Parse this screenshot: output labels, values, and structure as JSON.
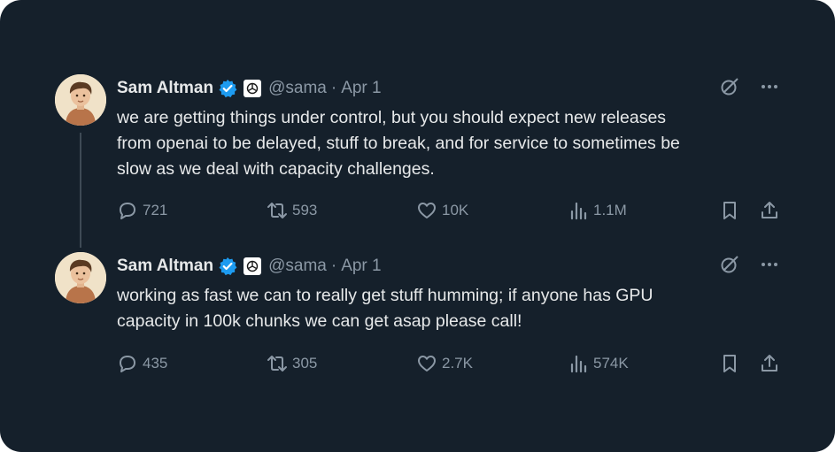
{
  "tweets": [
    {
      "author_name": "Sam Altman",
      "handle": "@sama",
      "separator": "·",
      "date": "Apr 1",
      "text": "we are getting things under control, but you should expect new releases\nfrom openai to be delayed, stuff to break, and for service to sometimes be\nslow as we deal with capacity challenges.",
      "stats": {
        "replies": "721",
        "retweets": "593",
        "likes": "10K",
        "views": "1.1M"
      }
    },
    {
      "author_name": "Sam Altman",
      "handle": "@sama",
      "separator": "·",
      "date": "Apr 1",
      "text": "working as fast we can to really get stuff humming; if anyone has GPU\ncapacity in 100k chunks we can get asap please call!",
      "stats": {
        "replies": "435",
        "retweets": "305",
        "likes": "2.7K",
        "views": "574K"
      }
    }
  ],
  "icons": {
    "verified": "verified-badge-icon",
    "affiliation": "openai-logo-icon",
    "grok": "grok-icon",
    "more": "more-options-icon",
    "reply": "reply-icon",
    "retweet": "retweet-icon",
    "like": "heart-icon",
    "views": "views-icon",
    "bookmark": "bookmark-icon",
    "share": "share-icon"
  },
  "colors": {
    "background": "#15202b",
    "text_primary": "#e7e9ea",
    "text_secondary": "#8b98a5",
    "verified_blue": "#1d9bf0",
    "thread_line": "#3e4a55"
  }
}
